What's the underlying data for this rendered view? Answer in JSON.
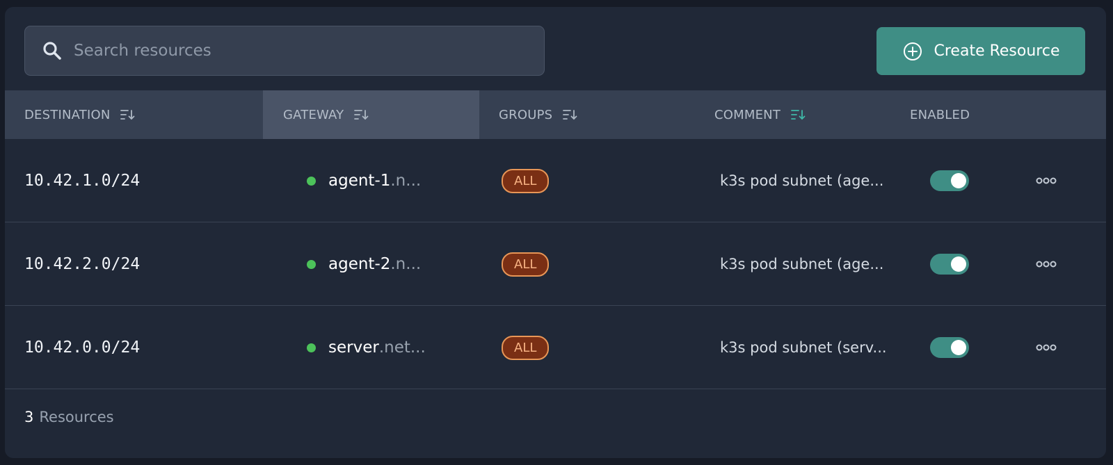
{
  "search": {
    "placeholder": "Search resources",
    "value": ""
  },
  "toolbar": {
    "create_label": "Create Resource"
  },
  "columns": {
    "destination": "DESTINATION",
    "gateway": "GATEWAY",
    "groups": "GROUPS",
    "comment": "COMMENT",
    "enabled": "ENABLED"
  },
  "rows": [
    {
      "destination": "10.42.1.0/24",
      "gateway_name": "agent-1",
      "gateway_suffix": ".n...",
      "group": "ALL",
      "comment": "k3s pod subnet (age...",
      "enabled": true
    },
    {
      "destination": "10.42.2.0/24",
      "gateway_name": "agent-2",
      "gateway_suffix": ".n...",
      "group": "ALL",
      "comment": "k3s pod subnet (age...",
      "enabled": true
    },
    {
      "destination": "10.42.0.0/24",
      "gateway_name": "server",
      "gateway_suffix": ".net...",
      "group": "ALL",
      "comment": "k3s pod subnet (serv...",
      "enabled": true
    }
  ],
  "footer": {
    "count": "3",
    "label": "Resources"
  },
  "colors": {
    "accent": "#3f8e85",
    "status_online": "#4cc25a",
    "badge_border": "#e89657",
    "badge_bg": "#7a2f14",
    "sort_active": "#3fb8a8"
  },
  "icons": {
    "search": "search-icon",
    "create": "plus-circle-icon",
    "sort": "sort-descending-icon",
    "more": "more-horizontal-icon"
  }
}
